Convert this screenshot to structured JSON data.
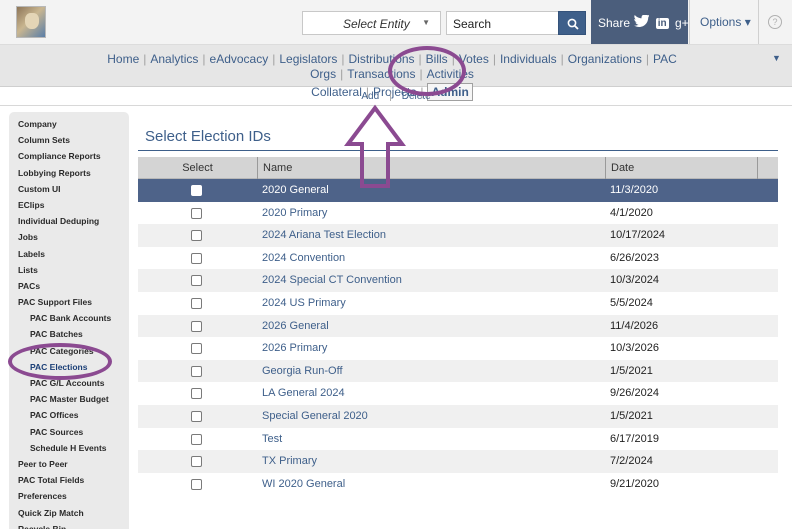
{
  "topbar": {
    "logo_icon": "dog-photo-logo",
    "entity_label": "Select Entity",
    "entity_caret": "▼",
    "search_value": "Search",
    "share_label": "Share",
    "share_icons": [
      "twitter-icon",
      "linkedin-icon",
      "google-plus-icon"
    ],
    "linkedin_glyph": "in",
    "gplus_glyph": "g+",
    "options_label": "Options ▾",
    "help_glyph": "?"
  },
  "nav": {
    "row1": [
      "Home",
      "Analytics",
      "eAdvocacy",
      "Legislators",
      "Distributions",
      "Bills",
      "Votes",
      "Individuals",
      "Organizations",
      "PAC Orgs",
      "Transactions",
      "Activities"
    ],
    "row2": [
      "Collateral",
      "Projects",
      "Admin"
    ],
    "active": "Admin",
    "collapse_glyph": "▼"
  },
  "subnav": {
    "add": "Add",
    "separator": "|",
    "delete": "Delete"
  },
  "sidebar": {
    "items": [
      {
        "label": "Company",
        "sub": false
      },
      {
        "label": "Column Sets",
        "sub": false
      },
      {
        "label": "Compliance Reports",
        "sub": false
      },
      {
        "label": "Lobbying Reports",
        "sub": false
      },
      {
        "label": "Custom UI",
        "sub": false
      },
      {
        "label": "EClips",
        "sub": false
      },
      {
        "label": "Individual Deduping",
        "sub": false
      },
      {
        "label": "Jobs",
        "sub": false
      },
      {
        "label": "Labels",
        "sub": false
      },
      {
        "label": "Lists",
        "sub": false
      },
      {
        "label": "PACs",
        "sub": false
      },
      {
        "label": "PAC Support Files",
        "sub": false
      },
      {
        "label": "PAC Bank Accounts",
        "sub": true
      },
      {
        "label": "PAC Batches",
        "sub": true
      },
      {
        "label": "PAC Categories",
        "sub": true
      },
      {
        "label": "PAC Elections",
        "sub": true,
        "current": true
      },
      {
        "label": "PAC G/L Accounts",
        "sub": true
      },
      {
        "label": "PAC Master Budget",
        "sub": true
      },
      {
        "label": "PAC Offices",
        "sub": true
      },
      {
        "label": "PAC Sources",
        "sub": true
      },
      {
        "label": "Schedule H Events",
        "sub": true
      },
      {
        "label": "Peer to Peer",
        "sub": false
      },
      {
        "label": "PAC Total Fields",
        "sub": false
      },
      {
        "label": "Preferences",
        "sub": false
      },
      {
        "label": "Quick Zip Match",
        "sub": false
      },
      {
        "label": "Recycle Bin",
        "sub": false
      }
    ]
  },
  "main": {
    "title": "Select Election IDs",
    "columns": [
      "Select",
      "Name",
      "Date"
    ],
    "rows": [
      {
        "name": "2020 General",
        "date": "11/3/2020",
        "selected": true
      },
      {
        "name": "2020 Primary",
        "date": "4/1/2020",
        "selected": false
      },
      {
        "name": "2024 Ariana Test Election",
        "date": "10/17/2024",
        "selected": false
      },
      {
        "name": "2024 Convention",
        "date": "6/26/2023",
        "selected": false
      },
      {
        "name": "2024 Special CT Convention",
        "date": "10/3/2024",
        "selected": false
      },
      {
        "name": "2024 US Primary",
        "date": "5/5/2024",
        "selected": false
      },
      {
        "name": "2026 General",
        "date": "11/4/2026",
        "selected": false
      },
      {
        "name": "2026 Primary",
        "date": "10/3/2026",
        "selected": false
      },
      {
        "name": "Georgia Run-Off",
        "date": "1/5/2021",
        "selected": false
      },
      {
        "name": "LA General 2024",
        "date": "9/26/2024",
        "selected": false
      },
      {
        "name": "Special General 2020",
        "date": "1/5/2021",
        "selected": false
      },
      {
        "name": "Test",
        "date": "6/17/2019",
        "selected": false
      },
      {
        "name": "TX Primary",
        "date": "7/2/2024",
        "selected": false
      },
      {
        "name": "WI 2020 General",
        "date": "9/21/2020",
        "selected": false
      }
    ]
  },
  "colors": {
    "accent": "#3e5f8a",
    "selected_row": "#4e6389",
    "annotation": "#8b4a91"
  }
}
